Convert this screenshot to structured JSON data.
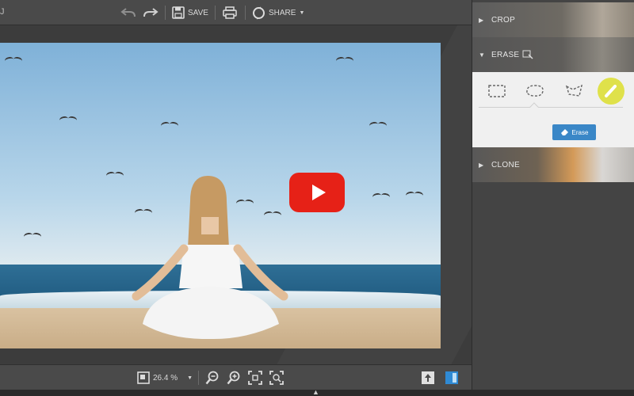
{
  "toolbar": {
    "left_glyph": "J",
    "undo_icon": "undo-icon",
    "redo_icon": "redo-icon",
    "save_label": "SAVE",
    "share_label": "SHARE"
  },
  "bottombar": {
    "zoom_value": "26.4 %"
  },
  "panel": {
    "sections": [
      {
        "label": "CROP",
        "expanded": false
      },
      {
        "label": "ERASE",
        "expanded": true
      },
      {
        "label": "CLONE",
        "expanded": false
      }
    ],
    "erase_tools": [
      "rectangle-select-icon",
      "lasso-icon",
      "polygon-lasso-icon",
      "brush-icon"
    ],
    "erase_button_label": "Erase"
  },
  "video": {
    "play_icon": "play-icon"
  },
  "colors": {
    "accent_blue": "#3a87c7",
    "active_tool": "#dfe14a",
    "play_red": "#e62117"
  }
}
